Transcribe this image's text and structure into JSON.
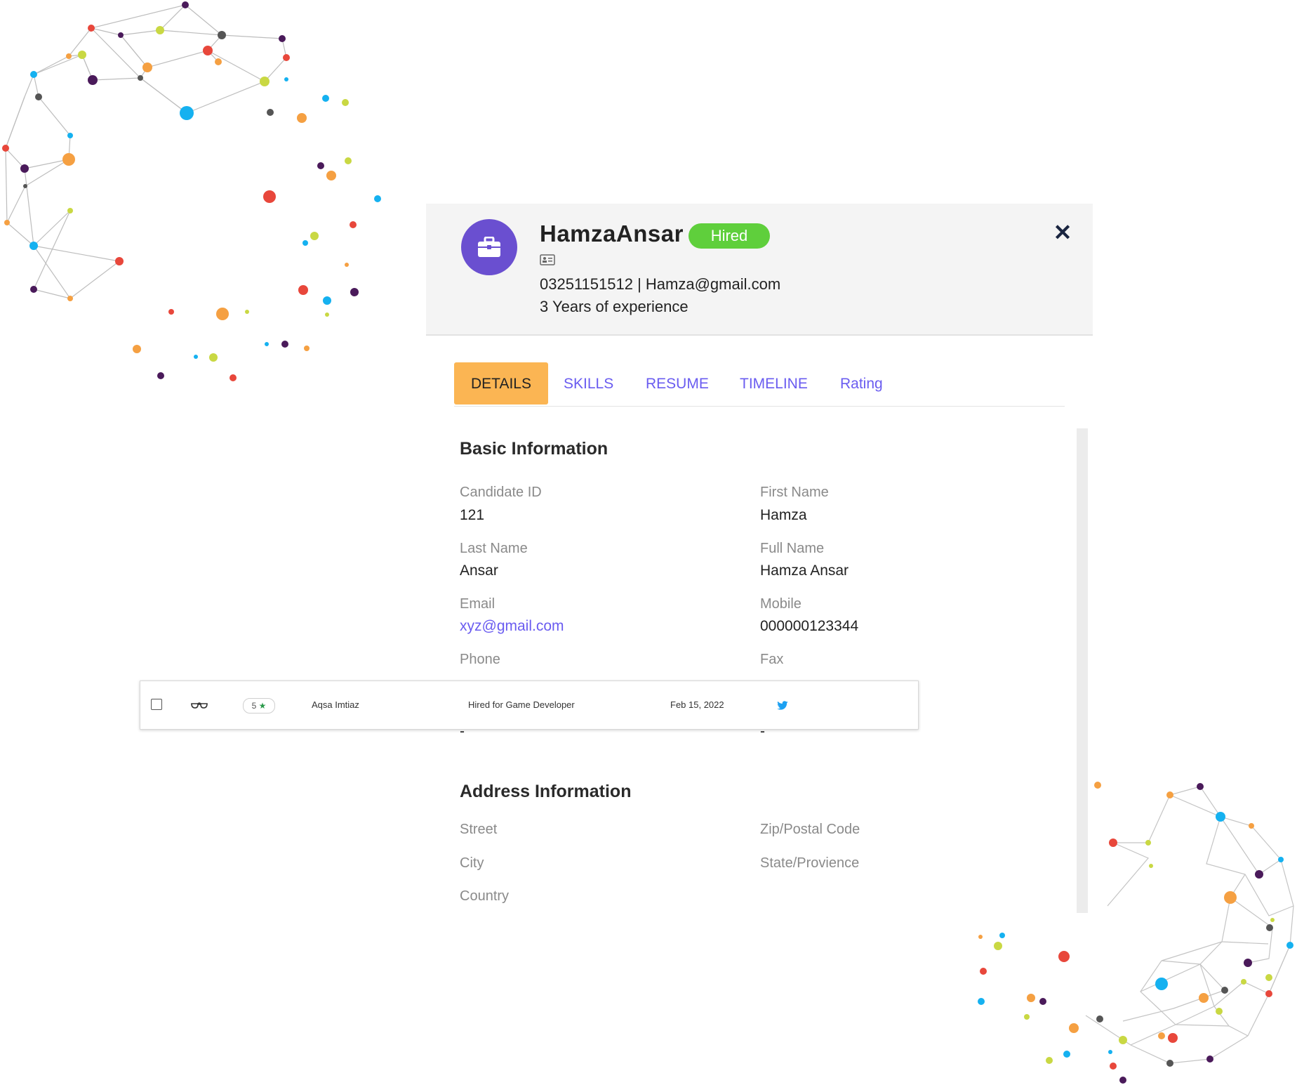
{
  "candidate": {
    "name": "HamzaAnsar",
    "status": "Hired",
    "contact": "03251151512 | Hamza@gmail.com",
    "experience": "3 Years of experience"
  },
  "tabs": [
    "DETAILS",
    "SKILLS",
    "RESUME",
    "TIMELINE",
    "Rating"
  ],
  "active_tab": "DETAILS",
  "basic": {
    "title": "Basic Information",
    "candidate_id_label": "Candidate ID",
    "candidate_id": "121",
    "first_name_label": "First Name",
    "first_name": "Hamza",
    "last_name_label": "Last Name",
    "last_name": "Ansar",
    "full_name_label": "Full Name",
    "full_name": "Hamza Ansar",
    "email_label": "Email",
    "email": "xyz@gmail.com",
    "mobile_label": "Mobile",
    "mobile": "000000123344",
    "phone_label": "Phone",
    "phone": "-",
    "fax_label": "Fax",
    "fax": "-"
  },
  "address": {
    "title": "Address Information",
    "street_label": "Street",
    "zip_label": "Zip/Postal Code",
    "city_label": "City",
    "state_label": "State/Provience",
    "country_label": "Country"
  },
  "list_row": {
    "rating": "5",
    "name": "Aqsa Imtiaz",
    "status": "Hired for Game Developer",
    "date": "Feb 15, 2022"
  },
  "colors": {
    "accent": "#6a5cf0",
    "avatar": "#6a4fd0",
    "badge": "#5fcf3c",
    "active_tab": "#fbb553",
    "twitter": "#1da1f2"
  },
  "icons": {
    "avatar": "briefcase-icon",
    "id_card": "id-card-icon",
    "close": "close-icon",
    "view": "glasses-icon",
    "star": "star-icon",
    "social": "twitter-icon"
  }
}
